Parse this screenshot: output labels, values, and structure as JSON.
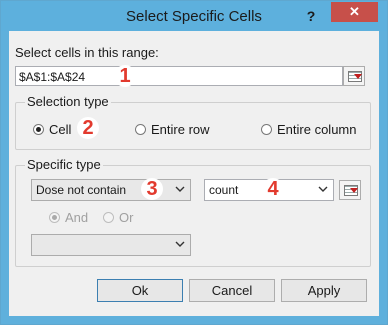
{
  "window": {
    "title": "Select Specific Cells",
    "help_glyph": "?",
    "close_glyph": "✕"
  },
  "range": {
    "label": "Select cells in this range:",
    "value": "$A$1:$A$24"
  },
  "selection_type": {
    "title": "Selection type",
    "options": [
      "Cell",
      "Entire row",
      "Entire column"
    ],
    "selected": "Cell"
  },
  "specific_type": {
    "title": "Specific type",
    "condition1": "Dose not contain",
    "value1": "count",
    "and_label": "And",
    "or_label": "Or",
    "logic_selected": "And",
    "condition2": ""
  },
  "buttons": {
    "ok": "Ok",
    "cancel": "Cancel",
    "apply": "Apply"
  },
  "step_badges": [
    "1",
    "2",
    "3",
    "4"
  ],
  "colors": {
    "titlebar": "#5db0dd",
    "close": "#c7504a",
    "badge": "#e23a2e"
  }
}
